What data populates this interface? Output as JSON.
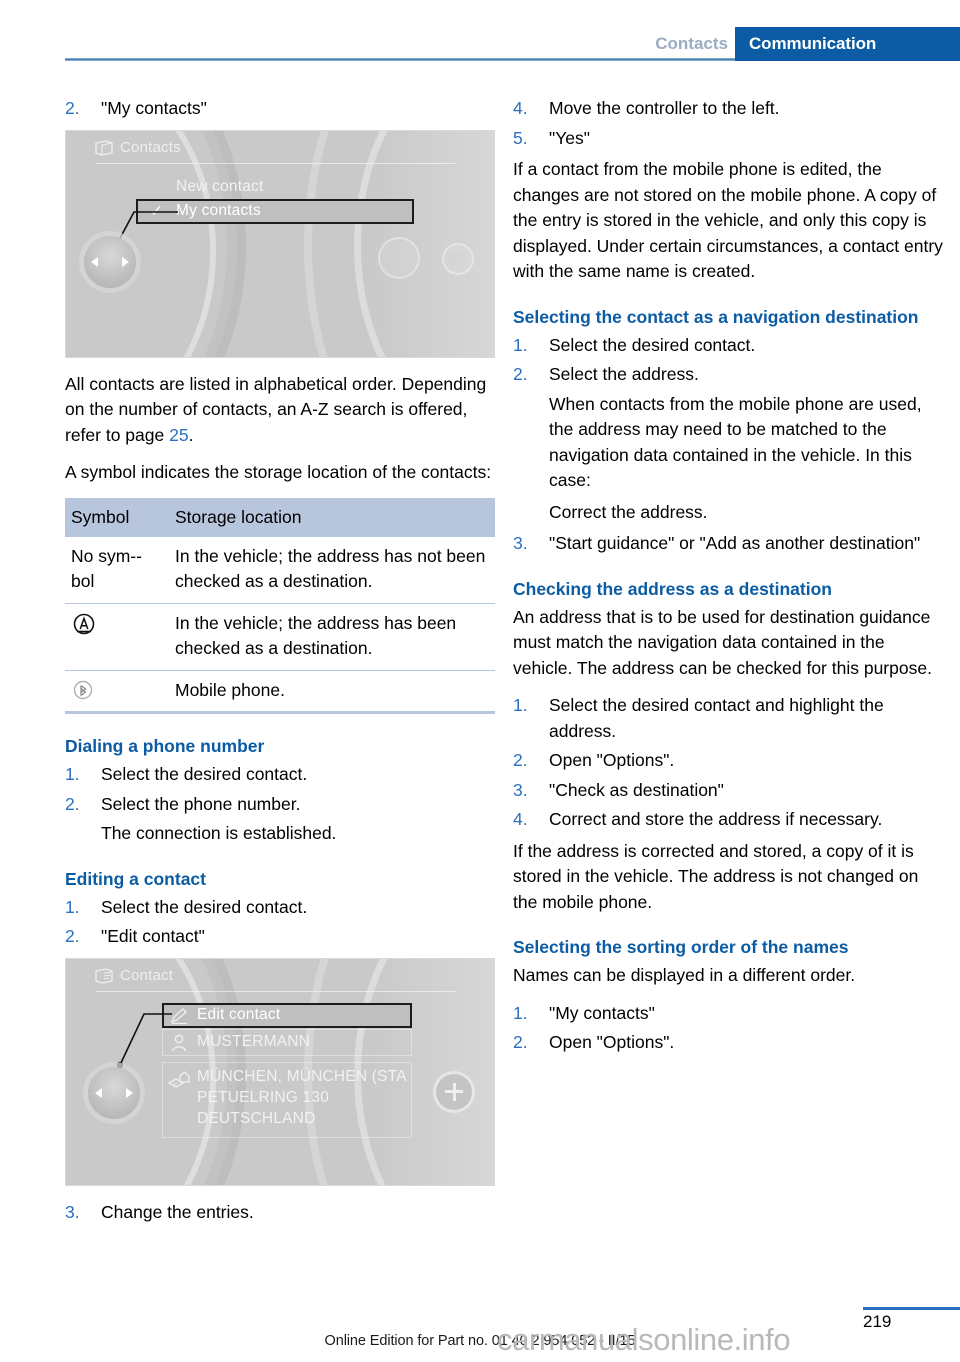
{
  "header": {
    "breadcrumb_secondary": "Contacts",
    "breadcrumb_primary": "Communication"
  },
  "left_column": {
    "step2_num": "2.",
    "step2_text": "\"My contacts\"",
    "screenshot1": {
      "title": "Contacts",
      "title_icon": "contacts-book-icon",
      "items": [
        {
          "label": "New contact",
          "checked": false,
          "highlighted": false
        },
        {
          "label": "My contacts",
          "checked": true,
          "highlighted": true
        }
      ],
      "check_glyph": "✓",
      "controller_icon": "idrive-controller-left-right",
      "right_icons": [
        "contact-card-icon",
        "phone-book-icon"
      ]
    },
    "para1": "All contacts are listed in alphabetical order. Depending on the number of contacts, an A-Z search is offered, refer to page ",
    "para1_pageref": "25",
    "para1_tail": ".",
    "para2": "A symbol indicates the storage location of the contacts:",
    "table": {
      "headers": [
        "Symbol",
        "Storage location"
      ],
      "rows": [
        {
          "symbol_text": "No sym-­ bol",
          "symbol_icon": "",
          "location": "In the vehicle; the address has not been checked as a destination."
        },
        {
          "symbol_text": "",
          "symbol_icon": "nav-checked-circle-a-icon",
          "location": "In the vehicle; the address has been checked as a destination."
        },
        {
          "symbol_text": "",
          "symbol_icon": "bluetooth-mobile-phone-icon",
          "location": "Mobile phone."
        }
      ]
    },
    "section_dialing": {
      "heading": "Dialing a phone number",
      "steps": [
        {
          "num": "1.",
          "text": "Select the desired contact."
        },
        {
          "num": "2.",
          "text": "Select the phone number."
        }
      ],
      "note": "The connection is established."
    },
    "section_editing": {
      "heading": "Editing a contact",
      "steps": [
        {
          "num": "1.",
          "text": "Select the desired contact."
        },
        {
          "num": "2.",
          "text": "\"Edit contact\""
        }
      ]
    },
    "screenshot2": {
      "title": "Contact",
      "title_icon": "contact-card-icon",
      "row_edit": {
        "label": "Edit contact",
        "icon": "pencil-edit-icon",
        "highlighted": true
      },
      "row_name": {
        "label": "MUSTERMANN",
        "icon": "person-icon"
      },
      "row_address": {
        "icon": "map-house-icon",
        "lines": [
          "MÜNCHEN, MÜNCHEN (STA",
          "PETUELRING 130",
          "DEUTSCHLAND"
        ]
      },
      "plus_button_icon": "plus-icon",
      "controller_icon": "idrive-controller-left-right"
    },
    "step3_num": "3.",
    "step3_text": "Change the entries."
  },
  "right_column": {
    "steps_top": [
      {
        "num": "4.",
        "text": "Move the controller to the left."
      },
      {
        "num": "5.",
        "text": "\"Yes\""
      }
    ],
    "para_edit_note": "If a contact from the mobile phone is edited, the changes are not stored on the mobile phone. A copy of the entry is stored in the ve­hicle, and only this copy is displayed. Under certain circumstances, a contact entry with the same name is created.",
    "section_nav_dest": {
      "heading": "Selecting the contact as a navigation destination",
      "steps": [
        {
          "num": "1.",
          "text": "Select the desired contact."
        },
        {
          "num": "2.",
          "text": "Select the address."
        }
      ],
      "note1": "When contacts from the mobile phone are used, the address may need to be matched to the navigation data contained in the ve­hicle. In this case:",
      "note2": "Correct the address.",
      "step3": {
        "num": "3.",
        "text": "\"Start guidance\" or \"Add as another destination\""
      }
    },
    "section_checking": {
      "heading": "Checking the address as a destination",
      "para": "An address that is to be used for destination guidance must match the navigation data con­tained in the vehicle. The address can be checked for this purpose.",
      "steps": [
        {
          "num": "1.",
          "text": "Select the desired contact and highlight the address."
        },
        {
          "num": "2.",
          "text": "Open \"Options\"."
        },
        {
          "num": "3.",
          "text": "\"Check as destination\""
        },
        {
          "num": "4.",
          "text": "Correct and store the address if necessary."
        }
      ],
      "para_after": "If the address is corrected and stored, a copy of it is stored in the vehicle. The address is not changed on the mobile phone."
    },
    "section_sorting": {
      "heading": "Selecting the sorting order of the names",
      "para": "Names can be displayed in a different order.",
      "steps": [
        {
          "num": "1.",
          "text": "\"My contacts\""
        },
        {
          "num": "2.",
          "text": "Open \"Options\"."
        }
      ]
    }
  },
  "footer": {
    "page_number": "219",
    "edition_text": "Online Edition for Part no. 01 40 2 954 052 - II/15",
    "watermark": "carmanualsonline.info"
  },
  "colors": {
    "accent_blue": "#0b5ca4",
    "link_blue": "#2a6fc0",
    "table_header": "#b7c6dd",
    "muted_tab": "#9aadc4"
  }
}
